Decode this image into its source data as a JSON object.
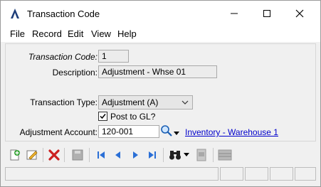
{
  "window": {
    "title": "Transaction Code"
  },
  "menu": [
    "File",
    "Record",
    "Edit",
    "View",
    "Help"
  ],
  "form": {
    "transaction_code": {
      "label": "Transaction Code:",
      "value": "1"
    },
    "description": {
      "label": "Description:",
      "value": "Adjustment - Whse 01"
    },
    "transaction_type": {
      "label": "Transaction Type:",
      "value": "Adjustment (A)"
    },
    "post_to_gl": {
      "label": "Post to GL?",
      "checked": true
    },
    "adjustment_account": {
      "label": "Adjustment Account:",
      "value": "120-001",
      "link_text": "Inventory - Warehouse 1"
    }
  },
  "icons": {
    "new": "new-record-icon",
    "edit": "edit-record-icon",
    "delete": "delete-icon",
    "save": "save-icon",
    "first": "first-record-icon",
    "prev": "previous-record-icon",
    "next": "next-record-icon",
    "last": "last-record-icon",
    "find": "binoculars-icon",
    "lookup": "search-icon"
  },
  "colors": {
    "link": "#0000cc",
    "delete_red": "#cc2020",
    "nav_blue": "#2a6fd6"
  }
}
